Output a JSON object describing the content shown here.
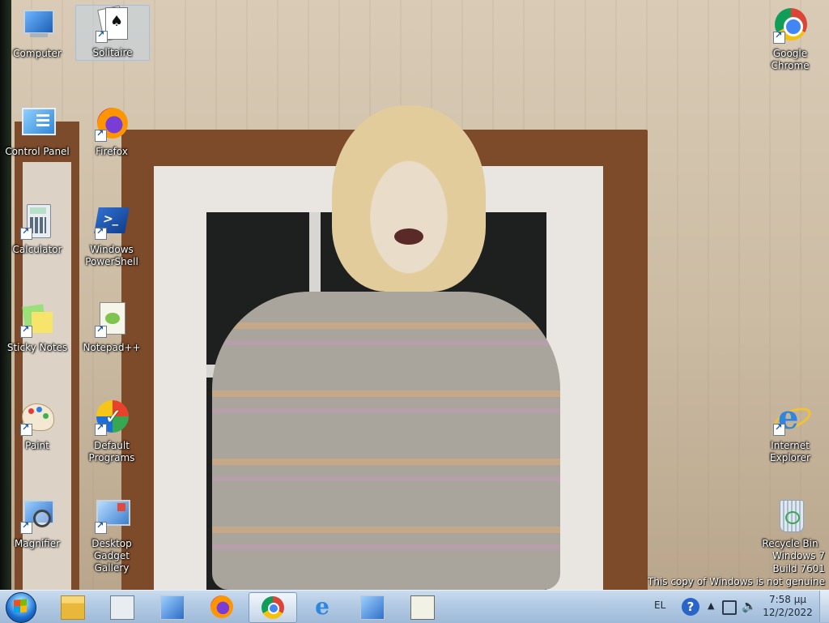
{
  "desktop_icons": [
    {
      "id": "computer",
      "label": "Computer",
      "shortcut": false
    },
    {
      "id": "solitaire",
      "label": "Solitaire",
      "shortcut": true,
      "selected": true
    },
    {
      "id": "chrome",
      "label": "Google Chrome",
      "shortcut": true
    },
    {
      "id": "control-panel",
      "label": "Control Panel",
      "shortcut": false
    },
    {
      "id": "firefox",
      "label": "Firefox",
      "shortcut": true
    },
    {
      "id": "calculator",
      "label": "Calculator",
      "shortcut": true
    },
    {
      "id": "powershell",
      "label": "Windows PowerShell",
      "shortcut": true
    },
    {
      "id": "sticky-notes",
      "label": "Sticky Notes",
      "shortcut": true
    },
    {
      "id": "notepadpp",
      "label": "Notepad++",
      "shortcut": true
    },
    {
      "id": "paint",
      "label": "Paint",
      "shortcut": true
    },
    {
      "id": "default-programs",
      "label": "Default Programs",
      "shortcut": true
    },
    {
      "id": "internet-explorer",
      "label": "Internet Explorer",
      "shortcut": true
    },
    {
      "id": "magnifier",
      "label": "Magnifier",
      "shortcut": true
    },
    {
      "id": "gadget-gallery",
      "label": "Desktop Gadget Gallery",
      "shortcut": true
    },
    {
      "id": "recycle-bin",
      "label": "Recycle Bin",
      "shortcut": false
    }
  ],
  "watermark": {
    "line1": "Windows 7",
    "line2": "Build 7601",
    "line3": "This copy of Windows is not genuine"
  },
  "taskbar": {
    "pinned": [
      {
        "id": "explorer",
        "icon": "folder-icon",
        "active": false
      },
      {
        "id": "calculator",
        "icon": "calculator-icon",
        "active": false
      },
      {
        "id": "remote-desktop",
        "icon": "monitor-icon",
        "active": false
      },
      {
        "id": "firefox",
        "icon": "firefox-icon",
        "active": false
      },
      {
        "id": "chrome",
        "icon": "chrome-icon",
        "active": true
      },
      {
        "id": "ie",
        "icon": "ie-icon",
        "active": false
      },
      {
        "id": "magnifier",
        "icon": "magnifier-icon",
        "active": false
      },
      {
        "id": "notepadpp",
        "icon": "notepadpp-icon",
        "active": false
      }
    ],
    "tray": {
      "language": "EL",
      "help_glyph": "?",
      "time": "7:58 μμ",
      "date": "12/2/2022"
    }
  },
  "colors": {
    "taskbar_top": "#c9dcef",
    "taskbar_bottom": "#9fbad8",
    "icon_label": "#ffffff"
  }
}
